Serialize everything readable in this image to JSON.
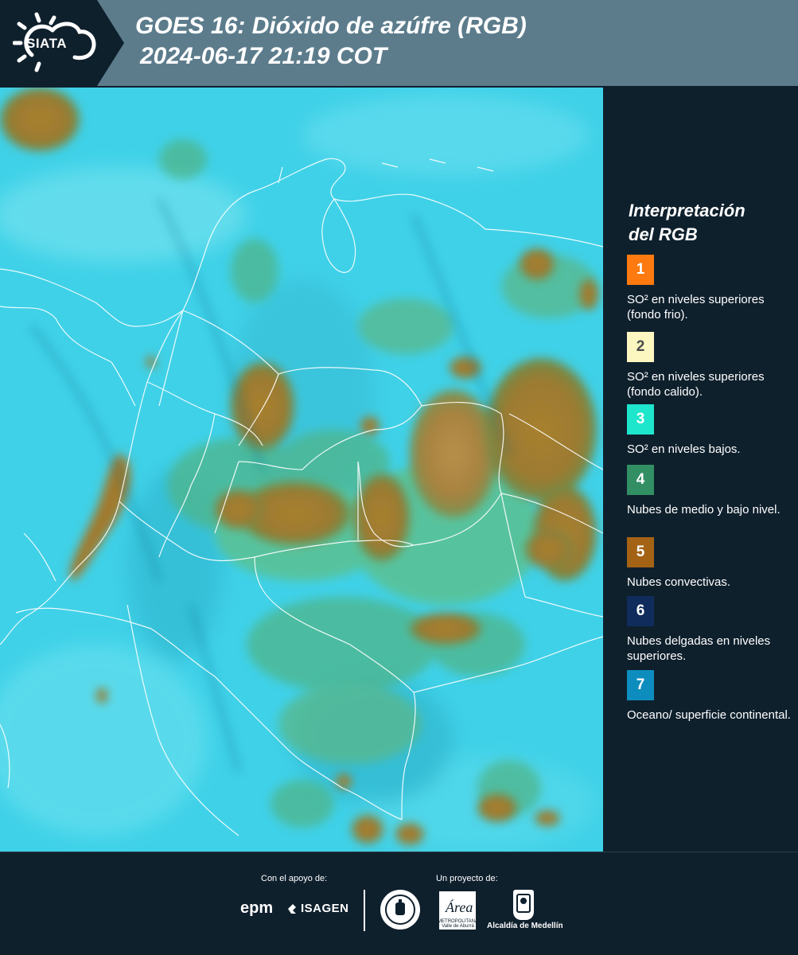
{
  "header": {
    "logo_text": "SIATA",
    "title": "GOES 16: Dióxido de azúfre (RGB)",
    "timestamp": "2024-06-17 21:19 COT"
  },
  "legend": {
    "title_line1": "Interpretación",
    "title_line2": "del RGB",
    "items": [
      {
        "number": "1",
        "color": "#fc7a0f",
        "text": "SO² en niveles superiores (fondo frio)."
      },
      {
        "number": "2",
        "color": "#fcf6c0",
        "text": "SO² en niveles superiores (fondo calido)."
      },
      {
        "number": "3",
        "color": "#1ee6cd",
        "text": "SO² en niveles bajos."
      },
      {
        "number": "4",
        "color": "#328f63",
        "text": "Nubes de medio y bajo nivel."
      },
      {
        "number": "5",
        "color": "#a46314",
        "text": "Nubes convectivas."
      },
      {
        "number": "6",
        "color": "#0f2c5c",
        "text": "Nubes delgadas en niveles superiores."
      },
      {
        "number": "7",
        "color": "#0d8dbd",
        "text": "Oceano/ superficie continental."
      }
    ]
  },
  "footer": {
    "support_label": "Con el apoyo de:",
    "project_label": "Un proyecto de:",
    "sponsor1": "epm",
    "sponsor2": "ISAGEN",
    "partner_area": "Área",
    "partner_area_caption": "METROPOLITANA Valle de Aburrá",
    "partner_alcaldia": "Alcaldía de Medellín"
  },
  "colors": {
    "background": "#0f202d",
    "header_bar": "#5c7c8c",
    "map_base": "#3fd1e8",
    "convective": "#a07a2e",
    "low_cloud": "#4fb58a",
    "border_lines": "#ffffff"
  }
}
